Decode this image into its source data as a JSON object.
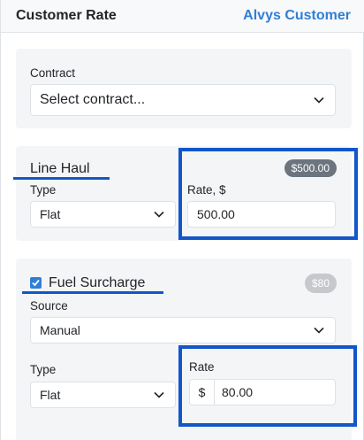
{
  "header": {
    "title": "Customer Rate",
    "link": "Alvys Customer"
  },
  "contract": {
    "label": "Contract",
    "selected": "Select contract..."
  },
  "line_haul": {
    "title": "Line Haul",
    "badge": "$500.00",
    "type_label": "Type",
    "type_value": "Flat",
    "rate_label": "Rate, $",
    "rate_value": "500.00"
  },
  "fuel_surcharge": {
    "title": "Fuel Surcharge",
    "checked": true,
    "badge": "$80",
    "source_label": "Source",
    "source_value": "Manual",
    "type_label": "Type",
    "type_value": "Flat",
    "rate_label": "Rate",
    "currency_symbol": "$",
    "rate_value": "80.00"
  },
  "colors": {
    "accent": "#2f7fd8",
    "annotation": "#1256c9",
    "badge_dark": "#6c757d",
    "badge_light": "#c6c8cc"
  },
  "icons": {
    "dropdown": "chevron-down-icon",
    "checkbox": "checkmark-icon"
  }
}
